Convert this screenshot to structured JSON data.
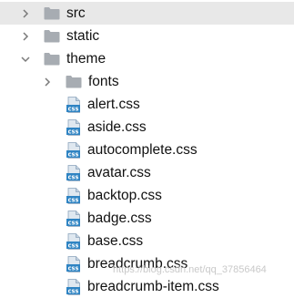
{
  "tree": {
    "items": [
      {
        "label": "src",
        "kind": "folder",
        "state": "collapsed",
        "depth": 0,
        "selected": true,
        "icon": "chevron-right-icon"
      },
      {
        "label": "static",
        "kind": "folder",
        "state": "collapsed",
        "depth": 0,
        "selected": false,
        "icon": "chevron-right-icon"
      },
      {
        "label": "theme",
        "kind": "folder",
        "state": "expanded",
        "depth": 0,
        "selected": false,
        "icon": "chevron-down-icon"
      },
      {
        "label": "fonts",
        "kind": "folder",
        "state": "collapsed",
        "depth": 1,
        "selected": false,
        "icon": "chevron-right-icon"
      },
      {
        "label": "alert.css",
        "kind": "css-file",
        "depth": 1
      },
      {
        "label": "aside.css",
        "kind": "css-file",
        "depth": 1
      },
      {
        "label": "autocomplete.css",
        "kind": "css-file",
        "depth": 1
      },
      {
        "label": "avatar.css",
        "kind": "css-file",
        "depth": 1
      },
      {
        "label": "backtop.css",
        "kind": "css-file",
        "depth": 1
      },
      {
        "label": "badge.css",
        "kind": "css-file",
        "depth": 1
      },
      {
        "label": "base.css",
        "kind": "css-file",
        "depth": 1
      },
      {
        "label": "breadcrumb.css",
        "kind": "css-file",
        "depth": 1
      },
      {
        "label": "breadcrumb-item.css",
        "kind": "css-file",
        "depth": 1
      }
    ]
  },
  "css_icon_text": "css",
  "watermark": "https://blog.csdn.net/qq_37856464",
  "colors": {
    "selected_row": "#e8e8e8",
    "folder": "#a7acb2",
    "css_icon_bg": "#2f84c3",
    "css_icon_page": "#dfe8f0",
    "chevron": "#7a7a7a"
  }
}
